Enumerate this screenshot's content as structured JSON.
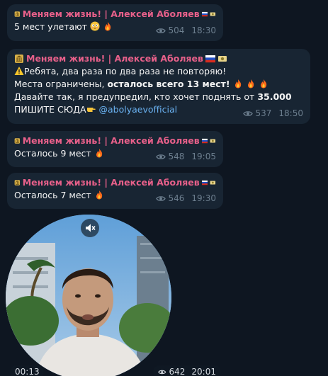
{
  "channel": {
    "name": "Меняем жизнь! | Алексей Аболяев"
  },
  "messages": [
    {
      "text": "5 мест улетают",
      "views": "504",
      "time": "18:30"
    },
    {
      "line1": "Ребята, два раза по два раза не повторяю!",
      "line2_prefix": "Места ограничены, ",
      "line2_bold": "осталось всего 13 мест!",
      "line3_prefix": "Давайте так, я предупредил, кто хочет поднять от ",
      "line3_bold": "35.000",
      "line4_prefix": "ПИШИТЕ СЮДА",
      "mention": "@abolyaevofficial",
      "views": "537",
      "time": "18:50"
    },
    {
      "text": "Осталось 9 мест",
      "views": "548",
      "time": "19:05"
    },
    {
      "text": "Осталось 7 мест",
      "views": "546",
      "time": "19:30"
    }
  ],
  "video": {
    "duration": "00:13",
    "views": "642",
    "time": "20:01",
    "muted": true
  },
  "colors": {
    "background": "#0e1621",
    "bubble": "#182533",
    "sender": "#e8608a",
    "meta": "#6d7f8f",
    "link": "#6ab2f2"
  }
}
